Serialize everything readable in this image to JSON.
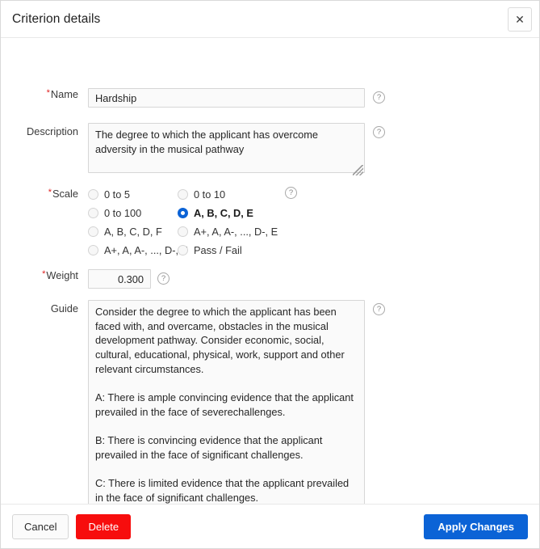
{
  "header": {
    "title": "Criterion details",
    "close_label": "✕"
  },
  "help_symbol": "?",
  "fields": {
    "name": {
      "label": "Name",
      "required": true,
      "value": "Hardship",
      "placeholder": ""
    },
    "description": {
      "label": "Description",
      "required": false,
      "value": "The degree to which the applicant has overcome adversity in the musical pathway",
      "placeholder": ""
    },
    "scale": {
      "label": "Scale",
      "required": true,
      "options": [
        {
          "label": "0 to 5",
          "selected": false
        },
        {
          "label": "0 to 10",
          "selected": false
        },
        {
          "label": "0 to 100",
          "selected": false
        },
        {
          "label": "A, B, C, D, E",
          "selected": true
        },
        {
          "label": "A, B, C, D, F",
          "selected": false
        },
        {
          "label": "A+, A, A-, ..., D-, E",
          "selected": false
        },
        {
          "label": "A+, A, A-, ..., D-, F",
          "selected": false
        },
        {
          "label": "Pass / Fail",
          "selected": false
        }
      ],
      "selected_value": "A, B, C, D, E"
    },
    "weight": {
      "label": "Weight",
      "required": true,
      "value": "0.300",
      "placeholder": ""
    },
    "guide": {
      "label": "Guide",
      "required": false,
      "value": "Consider the degree to which the applicant has been faced with, and overcame, obstacles in the musical development pathway. Consider economic, social, cultural, educational, physical, work, support and other relevant circumstances.\n\nA: There is ample convincing evidence that the applicant prevailed in the face of severechallenges.\n\nB: There is convincing evidence that the applicant prevailed in the face of significant challenges.\n\nC: There is limited evidence that the applicant prevailed in the face of significant challenges.\n\nD: There is limited evidence that the applicant prevailed in the face of minor challenges.\n\nE: No challenges apparent, or no evidence provided.",
      "placeholder": ""
    }
  },
  "footer": {
    "cancel_label": "Cancel",
    "delete_label": "Delete",
    "apply_label": "Apply Changes"
  },
  "colors": {
    "accent_blue": "#0b63d6",
    "danger_red": "#f70d0d",
    "required_star": "#e02020",
    "field_bg": "#fafafa",
    "border": "#d6d6d6"
  }
}
